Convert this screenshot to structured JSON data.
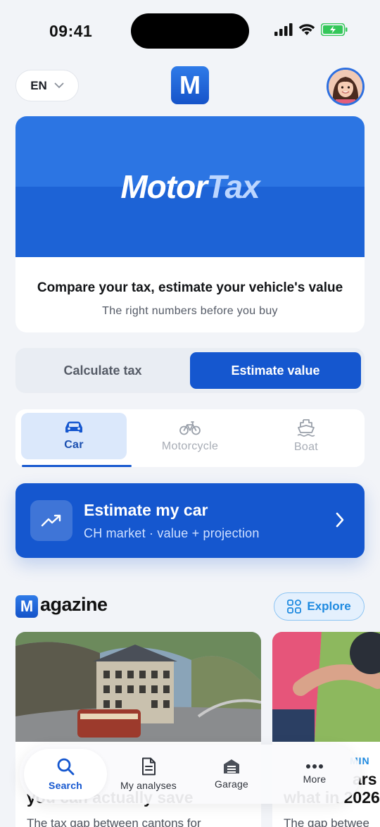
{
  "status_bar": {
    "time": "09:41"
  },
  "header": {
    "language": "EN",
    "logo_letter": "M"
  },
  "hero": {
    "brand_part1": "Motor",
    "brand_part2": "Tax",
    "title": "Compare your tax, estimate your vehicle's value",
    "subtitle": "The right numbers before you buy"
  },
  "mode_toggle": {
    "options": [
      "Calculate tax",
      "Estimate value"
    ],
    "selected": "Estimate value"
  },
  "vehicle_tabs": {
    "items": [
      {
        "label": "Car",
        "icon": "car-icon"
      },
      {
        "label": "Motorcycle",
        "icon": "bicycle-icon"
      },
      {
        "label": "Boat",
        "icon": "boat-icon"
      }
    ],
    "selected": "Car"
  },
  "cta": {
    "title": "Estimate my car",
    "subtitle": "CH market · value + projection",
    "icon": "trend-up-icon"
  },
  "magazine": {
    "logo_letter": "M",
    "word": "agazine",
    "explore_label": "Explore",
    "articles": [
      {
        "title": "you can actually save",
        "description": "The tax gap between cantons for",
        "image": "mountain-hotel-photo"
      },
      {
        "tag": "MIN",
        "title": "what in 2026",
        "title_top": "ars",
        "description": "The gap betwee",
        "image": "cyclist-photo"
      }
    ]
  },
  "bottom_nav": {
    "items": [
      {
        "label": "Search",
        "icon": "search-icon"
      },
      {
        "label": "My analyses",
        "icon": "document-icon"
      },
      {
        "label": "Garage",
        "icon": "garage-icon"
      },
      {
        "label": "More",
        "icon": "more-icon"
      }
    ],
    "selected": "Search"
  },
  "colors": {
    "primary": "#1557cf",
    "banner_blue": "#2c75e3",
    "accent_light_blue": "#1e8ae0",
    "background": "#f2f4f8"
  }
}
